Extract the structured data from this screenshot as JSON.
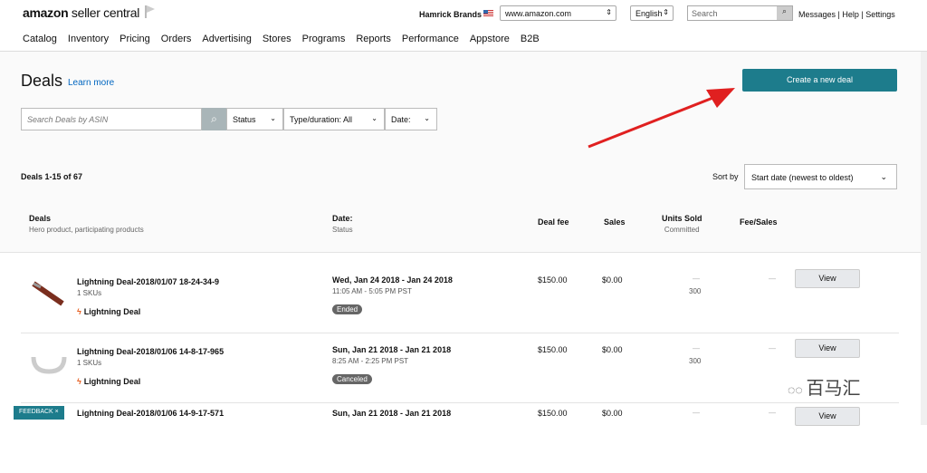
{
  "header": {
    "logo": "amazon seller central",
    "account": "Hamrick Brands",
    "marketplace": "www.amazon.com",
    "language": "English",
    "search_placeholder": "Search",
    "links": [
      "Messages",
      "Help",
      "Settings"
    ]
  },
  "nav": [
    "Catalog",
    "Inventory",
    "Pricing",
    "Orders",
    "Advertising",
    "Stores",
    "Programs",
    "Reports",
    "Performance",
    "Appstore",
    "B2B"
  ],
  "page": {
    "title": "Deals",
    "learn_more": "Learn more",
    "create_button": "Create a new deal"
  },
  "filters": {
    "search_placeholder": "Search Deals by ASIN",
    "status": "Status",
    "type": "Type/duration: All",
    "date": "Date:"
  },
  "list": {
    "count": "Deals 1-15 of 67",
    "sort_label": "Sort by",
    "sort_value": "Start date (newest to oldest)"
  },
  "columns": {
    "deals": "Deals",
    "deals_sub": "Hero product, participating products",
    "date": "Date:",
    "date_sub": "Status",
    "fee": "Deal fee",
    "sales": "Sales",
    "units": "Units Sold",
    "units_sub": "Committed",
    "fee_sales": "Fee/Sales"
  },
  "rows": [
    {
      "name": "Lightning Deal-2018/01/07 18-24-34-9",
      "skus": "1 SKUs",
      "type": "Lightning Deal",
      "date": "Wed, Jan 24 2018 - Jan 24 2018",
      "time": "11:05 AM - 5:05 PM PST",
      "status": "Ended",
      "fee": "$150.00",
      "sales": "$0.00",
      "units": "—",
      "committed": "300",
      "fee_sales": "—",
      "action": "View"
    },
    {
      "name": "Lightning Deal-2018/01/06 14-8-17-965",
      "skus": "1 SKUs",
      "type": "Lightning Deal",
      "date": "Sun, Jan 21 2018 - Jan 21 2018",
      "time": "8:25 AM - 2:25 PM PST",
      "status": "Canceled",
      "fee": "$150.00",
      "sales": "$0.00",
      "units": "—",
      "committed": "300",
      "fee_sales": "—",
      "action": "View"
    },
    {
      "name": "Lightning Deal-2018/01/06 14-9-17-571",
      "date": "Sun, Jan 21 2018 - Jan 21 2018",
      "fee": "$150.00",
      "sales": "$0.00",
      "units": "—",
      "fee_sales": "—",
      "action": "View"
    }
  ],
  "feedback": "FEEDBACK ×",
  "watermark": "百马汇",
  "colors": {
    "accent": "#1d7c8c",
    "arrow": "#e02020"
  }
}
